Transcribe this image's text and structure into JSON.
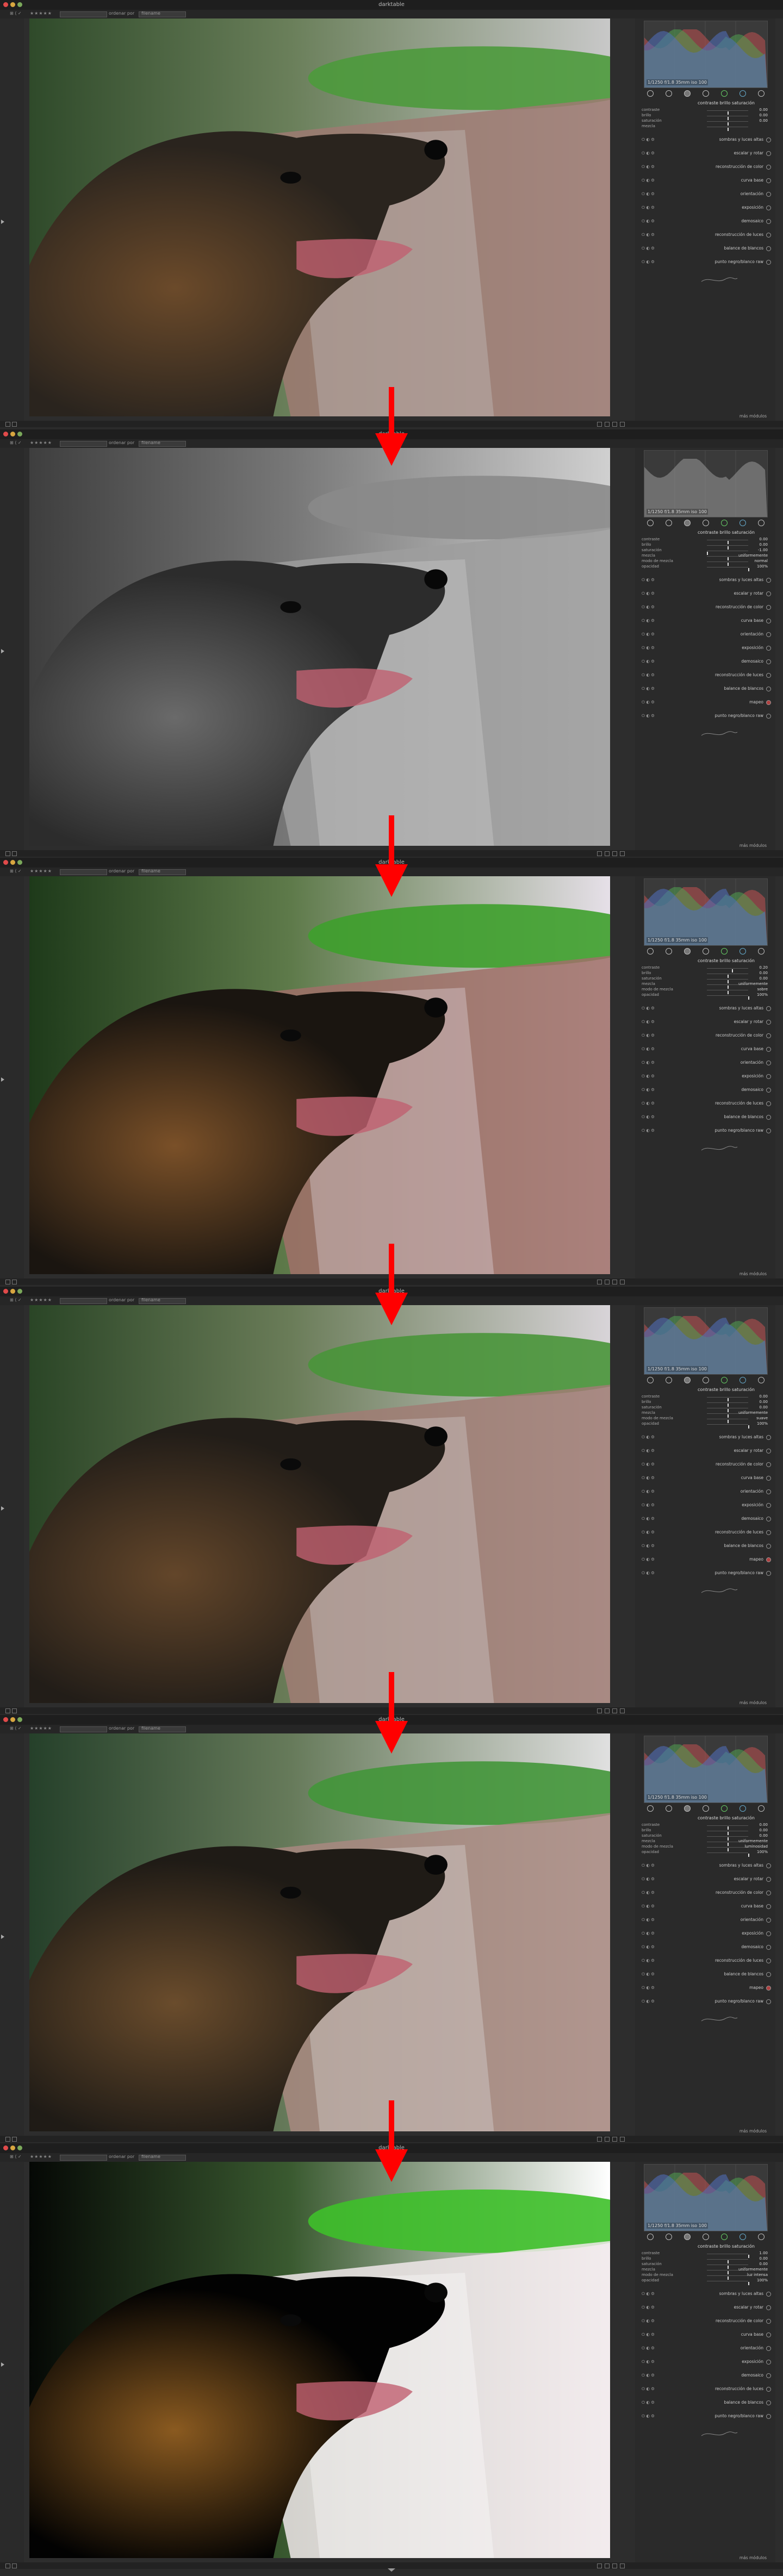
{
  "app": {
    "window_title": "darktable",
    "colors": {
      "arrow": "#ff0000",
      "close": "#e04a4a",
      "minimize": "#d8a640",
      "maximize": "#7aa85a"
    }
  },
  "toolbar": {
    "left_label": "⊞ ⟨ ✓",
    "rating": "★★★★★",
    "order_label": "ordenar por",
    "order_value": "filename"
  },
  "histogram": {
    "exif": "1/1250 f/1.8 35mm iso 100"
  },
  "module_tabs": [
    "active",
    "base",
    "tone",
    "color",
    "correct",
    "effect",
    "favourites"
  ],
  "panels": [
    {
      "variant": "original",
      "expanded_module": "contraste brillo saturación",
      "sliders": [
        {
          "label": "contraste",
          "value": "0.00",
          "pos": 0.5
        },
        {
          "label": "brillo",
          "value": "0.00",
          "pos": 0.5
        },
        {
          "label": "saturación",
          "value": "0.00",
          "pos": 0.5
        },
        {
          "label": "mezcla",
          "value": "",
          "pos": 0.5
        }
      ],
      "modules": [
        "sombras y luces altas",
        "escalar y rotar",
        "reconstrucción de color",
        "curva base",
        "orientación",
        "exposición",
        "demosaico",
        "reconstrucción de luces",
        "balance de blancos",
        "punto negro/blanco raw"
      ],
      "more": "más módulos"
    },
    {
      "variant": "desaturated",
      "expanded_module": "contraste brillo saturación",
      "sliders": [
        {
          "label": "contraste",
          "value": "0.00",
          "pos": 0.5
        },
        {
          "label": "brillo",
          "value": "0.00",
          "pos": 0.5
        },
        {
          "label": "saturación",
          "value": "-1.00",
          "pos": 0.0
        },
        {
          "label": "mezcla",
          "value": "uniformemente",
          "pos": 0.5
        },
        {
          "label": "modo de mezcla",
          "value": "normal",
          "pos": 0.5
        },
        {
          "label": "opacidad",
          "value": "100%",
          "pos": 1.0
        }
      ],
      "modules": [
        "sombras y luces altas",
        "escalar y rotar",
        "reconstrucción de color",
        "curva base",
        "orientación",
        "exposición",
        "demosaico",
        "reconstrucción de luces",
        "balance de blancos",
        "mapeo",
        "punto negro/blanco raw"
      ],
      "more": "más módulos"
    },
    {
      "variant": "contrast",
      "expanded_module": "contraste brillo saturación",
      "sliders": [
        {
          "label": "contraste",
          "value": "0.20",
          "pos": 0.6
        },
        {
          "label": "brillo",
          "value": "0.00",
          "pos": 0.5
        },
        {
          "label": "saturación",
          "value": "0.00",
          "pos": 0.5
        },
        {
          "label": "mezcla",
          "value": "uniformemente",
          "pos": 0.5
        },
        {
          "label": "modo de mezcla",
          "value": "sobre",
          "pos": 0.5
        },
        {
          "label": "opacidad",
          "value": "100%",
          "pos": 1.0
        }
      ],
      "modules": [
        "sombras y luces altas",
        "escalar y rotar",
        "reconstrucción de color",
        "curva base",
        "orientación",
        "exposición",
        "demosaico",
        "reconstrucción de luces",
        "balance de blancos",
        "punto negro/blanco raw"
      ],
      "more": "más módulos"
    },
    {
      "variant": "soft",
      "expanded_module": "contraste brillo saturación",
      "sliders": [
        {
          "label": "contraste",
          "value": "0.00",
          "pos": 0.5
        },
        {
          "label": "brillo",
          "value": "0.00",
          "pos": 0.5
        },
        {
          "label": "saturación",
          "value": "0.00",
          "pos": 0.5
        },
        {
          "label": "mezcla",
          "value": "uniformemente",
          "pos": 0.5
        },
        {
          "label": "modo de mezcla",
          "value": "suave",
          "pos": 0.5
        },
        {
          "label": "opacidad",
          "value": "100%",
          "pos": 1.0
        }
      ],
      "modules": [
        "sombras y luces altas",
        "escalar y rotar",
        "reconstrucción de color",
        "curva base",
        "orientación",
        "exposición",
        "demosaico",
        "reconstrucción de luces",
        "balance de blancos",
        "mapeo",
        "punto negro/blanco raw"
      ],
      "more": "más módulos"
    },
    {
      "variant": "warm",
      "expanded_module": "contraste brillo saturación",
      "sliders": [
        {
          "label": "contraste",
          "value": "0.00",
          "pos": 0.5
        },
        {
          "label": "brillo",
          "value": "0.00",
          "pos": 0.5
        },
        {
          "label": "saturación",
          "value": "0.00",
          "pos": 0.5
        },
        {
          "label": "mezcla",
          "value": "uniformemente",
          "pos": 0.5
        },
        {
          "label": "modo de mezcla",
          "value": "luminosidad",
          "pos": 0.5
        },
        {
          "label": "opacidad",
          "value": "100%",
          "pos": 1.0
        }
      ],
      "modules": [
        "sombras y luces altas",
        "escalar y rotar",
        "reconstrucción de color",
        "curva base",
        "orientación",
        "exposición",
        "demosaico",
        "reconstrucción de luces",
        "balance de blancos",
        "mapeo",
        "punto negro/blanco raw"
      ],
      "more": "más módulos"
    },
    {
      "variant": "highcontrast",
      "expanded_module": "contraste brillo saturación",
      "sliders": [
        {
          "label": "contraste",
          "value": "1.00",
          "pos": 1.0
        },
        {
          "label": "brillo",
          "value": "0.00",
          "pos": 0.5
        },
        {
          "label": "saturación",
          "value": "0.00",
          "pos": 0.5
        },
        {
          "label": "mezcla",
          "value": "uniformemente",
          "pos": 0.5
        },
        {
          "label": "modo de mezcla",
          "value": "luz intensa",
          "pos": 0.5
        },
        {
          "label": "opacidad",
          "value": "100%",
          "pos": 1.0
        }
      ],
      "modules": [
        "sombras y luces altas",
        "escalar y rotar",
        "reconstrucción de color",
        "curva base",
        "orientación",
        "exposición",
        "demosaico",
        "reconstrucción de luces",
        "balance de blancos",
        "punto negro/blanco raw"
      ],
      "more": "más módulos"
    }
  ]
}
